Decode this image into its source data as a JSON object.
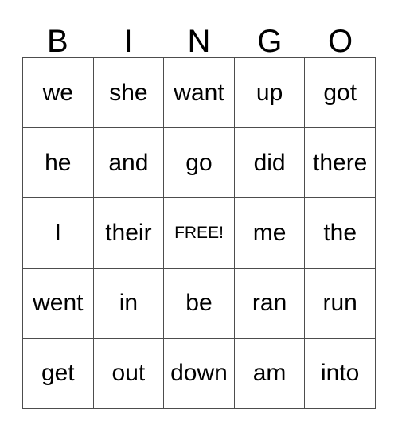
{
  "card": {
    "header_letters": [
      "B",
      "I",
      "N",
      "G",
      "O"
    ],
    "rows": [
      [
        "we",
        "she",
        "want",
        "up",
        "got"
      ],
      [
        "he",
        "and",
        "go",
        "did",
        "there"
      ],
      [
        "I",
        "their",
        "FREE!",
        "me",
        "the"
      ],
      [
        "went",
        "in",
        "be",
        "ran",
        "run"
      ],
      [
        "get",
        "out",
        "down",
        "am",
        "into"
      ]
    ],
    "free_space": {
      "row": 2,
      "column": 2,
      "label": "FREE!"
    },
    "colors": {
      "text": "#000000",
      "grid_line": "#4d4d4d",
      "background": "#ffffff"
    }
  }
}
